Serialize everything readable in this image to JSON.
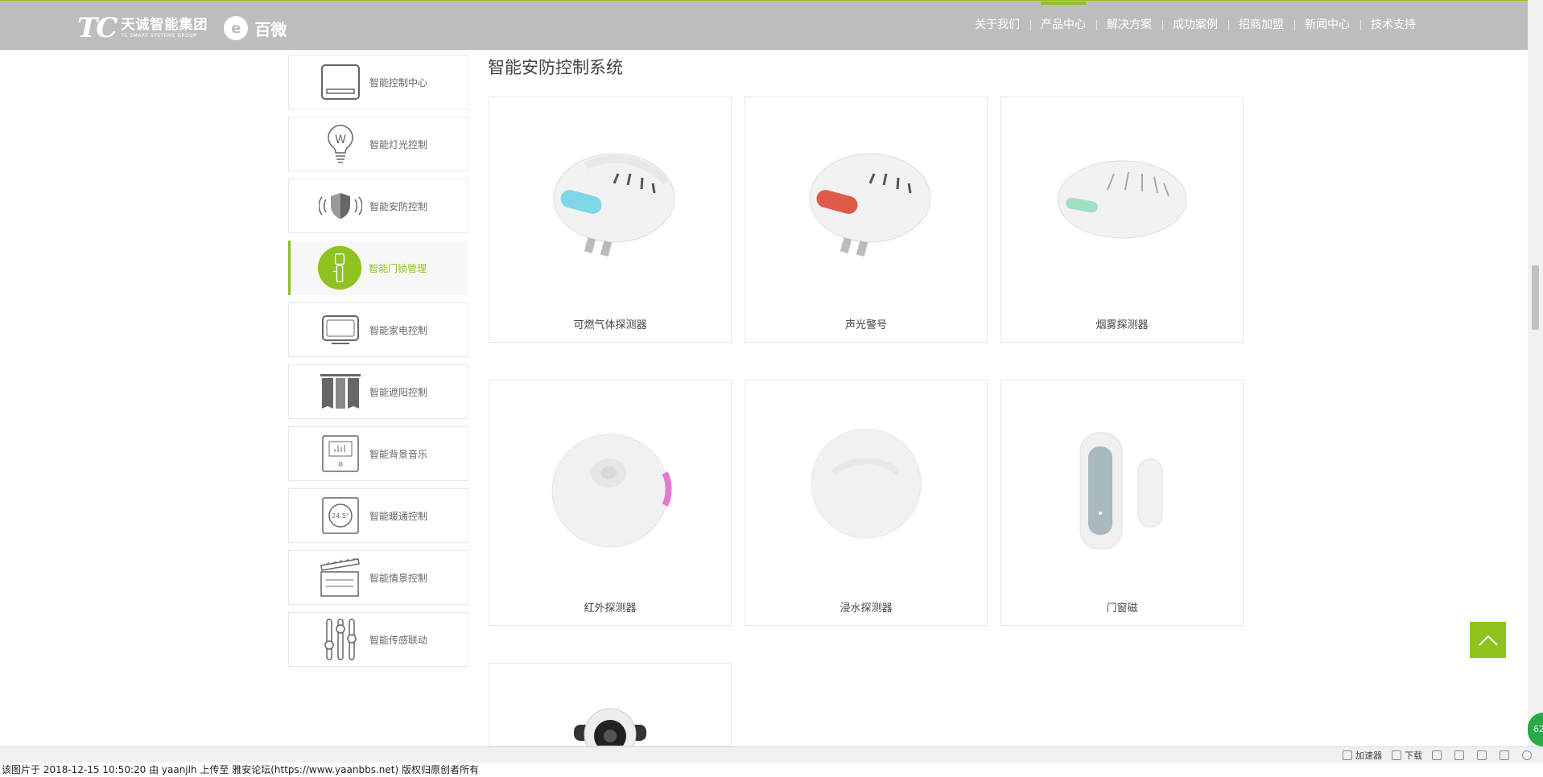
{
  "header": {
    "logo_mark": "TC",
    "logo_cn": "天诚智能集团",
    "logo_en": "TC SMART SYSTEMS GROUP",
    "logo2_mark": "e",
    "logo2_name": "百微",
    "nav": [
      {
        "label": "关于我们",
        "active": false
      },
      {
        "label": "产品中心",
        "active": true
      },
      {
        "label": "解决方案",
        "active": false
      },
      {
        "label": "成功案例",
        "active": false
      },
      {
        "label": "招商加盟",
        "active": false
      },
      {
        "label": "新闻中心",
        "active": false
      },
      {
        "label": "技术支持",
        "active": false
      }
    ]
  },
  "sidebar": {
    "items": [
      {
        "label": "智能控制中心",
        "icon": "control-panel-icon"
      },
      {
        "label": "智能灯光控制",
        "icon": "light-bulb-icon",
        "glyph": "W"
      },
      {
        "label": "智能安防控制",
        "icon": "shield-icon"
      },
      {
        "label": "智能门锁管理",
        "icon": "door-lock-icon",
        "active": true
      },
      {
        "label": "智能家电控制",
        "icon": "tv-icon"
      },
      {
        "label": "智能遮阳控制",
        "icon": "curtain-icon"
      },
      {
        "label": "智能背景音乐",
        "icon": "music-panel-icon"
      },
      {
        "label": "智能暖通控制",
        "icon": "thermostat-icon",
        "glyph": "24.5°"
      },
      {
        "label": "智能情景控制",
        "icon": "scene-board-icon"
      },
      {
        "label": "智能传感联动",
        "icon": "sliders-icon"
      }
    ]
  },
  "main": {
    "title": "智能安防控制系统",
    "products": [
      {
        "name": "可燃气体探测器",
        "label_color": "#7fd6e6"
      },
      {
        "name": "声光警号",
        "label_color": "#e05a4a"
      },
      {
        "name": "烟雾探测器",
        "label_color": "#9fe0c4"
      },
      {
        "name": "红外探测器",
        "label_color": "#e37ad1"
      },
      {
        "name": "浸水探测器",
        "label_color": ""
      },
      {
        "name": "门窗磁",
        "label_color": "#a8b9bf"
      },
      {
        "name": "",
        "label_color": ""
      }
    ]
  },
  "colors": {
    "accent": "#8fc31f",
    "header_bg": "#bdbdbd"
  },
  "badge": "62",
  "browser": {
    "tools": [
      "加速器",
      "下载"
    ]
  },
  "caption": "该图片于 2018-12-15 10:50:20 由 yaanjlh 上传至 雅安论坛(https://www.yaanbbs.net) 版权归原创者所有"
}
